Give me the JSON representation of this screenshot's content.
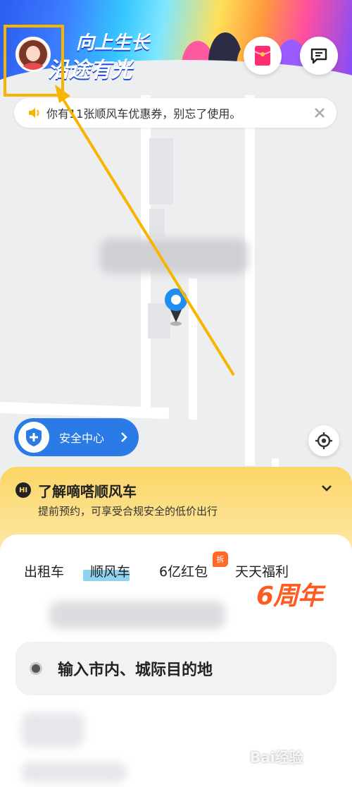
{
  "banner": {
    "slogan_line1": "向上生长",
    "slogan_line2": "沿途有光"
  },
  "notice": {
    "text": "你有11张顺风车优惠券，别忘了使用。"
  },
  "safety": {
    "label": "安全中心"
  },
  "info_card": {
    "title": "了解嘀嗒顺风车",
    "subtitle": "提前预约，可享受合规安全的低价出行",
    "icon_text": "HI"
  },
  "tabs": [
    {
      "label": "出租车"
    },
    {
      "label": "顺风车"
    },
    {
      "label": "6亿红包"
    },
    {
      "label": "天天福利"
    }
  ],
  "tab_badge": "拆",
  "anniversary": "6周年",
  "destination": {
    "placeholder": "输入市内、城际目的地"
  },
  "watermark": "Bai经验",
  "colors": {
    "accent_blue": "#2a7be6",
    "info_yellow": "#fbd565",
    "highlight": "#f7b500",
    "anniversary_orange": "#ff5a1f"
  }
}
